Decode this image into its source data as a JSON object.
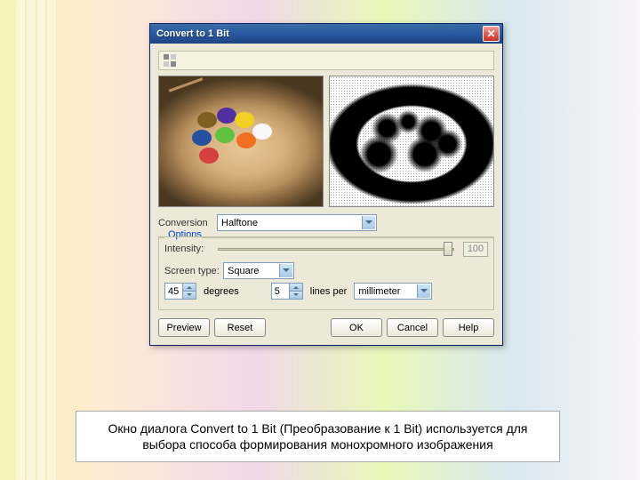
{
  "dialog": {
    "title": "Convert to 1 Bit",
    "conversion_label": "Conversion",
    "conversion_value": "Halftone",
    "options_title": "Options",
    "intensity_label": "Intensity:",
    "intensity_value": "100",
    "screen_type_label": "Screen type:",
    "screen_type_value": "Square",
    "angle_value": "45",
    "angle_unit": "degrees",
    "lines_value": "5",
    "lines_unit": "lines per",
    "unit_value": "millimeter",
    "buttons": {
      "preview": "Preview",
      "reset": "Reset",
      "ok": "OK",
      "cancel": "Cancel",
      "help": "Help"
    }
  },
  "caption": "Окно диалога Convert to 1 Bit (Преобразование к 1 Bit) используется для выбора способа формирования монохромного изображения"
}
